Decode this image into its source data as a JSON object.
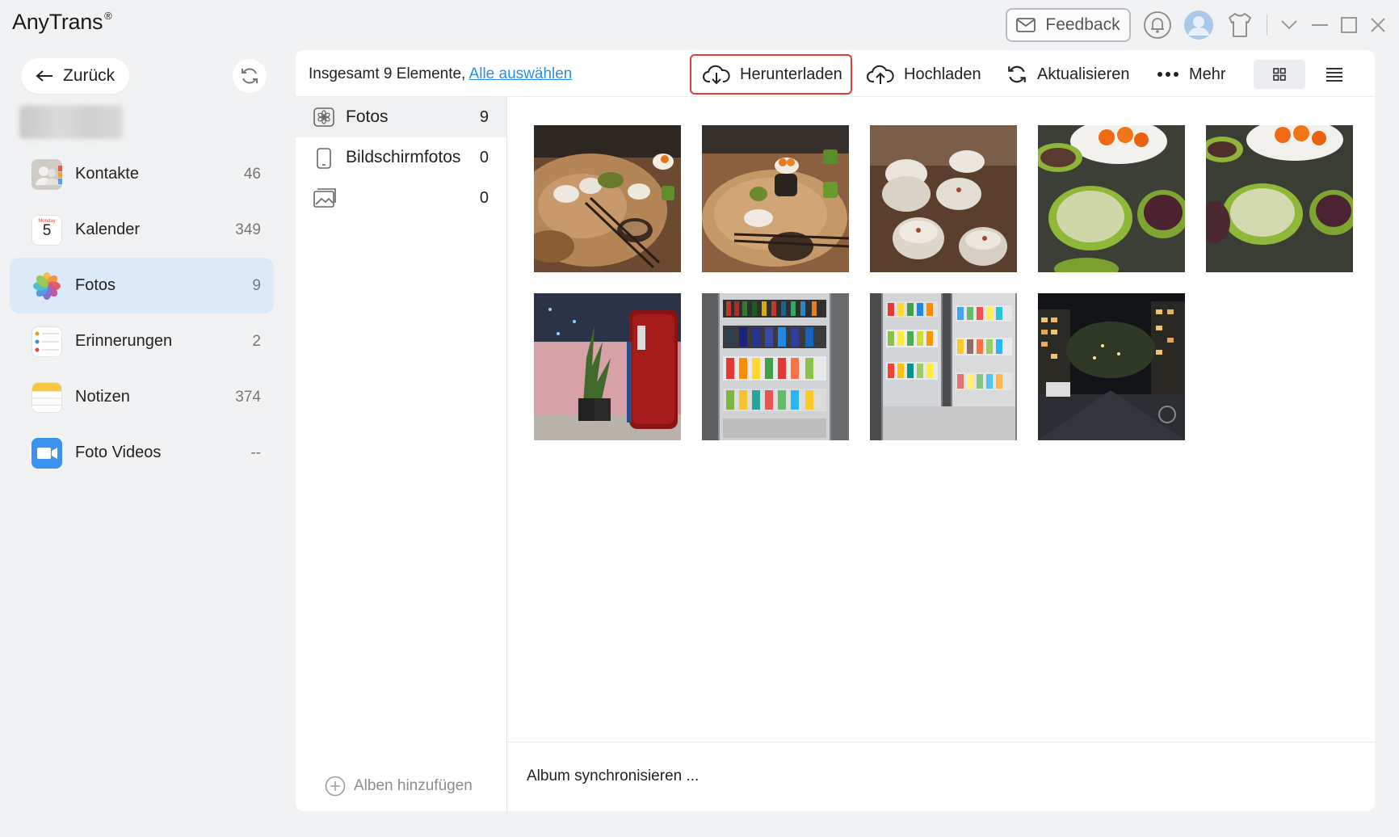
{
  "app": {
    "title": "AnyTrans",
    "registered": "®"
  },
  "titlebar": {
    "feedback_label": "Feedback"
  },
  "sidebar": {
    "back_label": "Zurück",
    "items": [
      {
        "label": "Kontakte",
        "count": "46",
        "icon": "contacts-icon"
      },
      {
        "label": "Kalender",
        "count": "349",
        "icon": "calendar-icon",
        "day": "5"
      },
      {
        "label": "Fotos",
        "count": "9",
        "icon": "photos-icon",
        "active": true
      },
      {
        "label": "Erinnerungen",
        "count": "2",
        "icon": "reminders-icon"
      },
      {
        "label": "Notizen",
        "count": "374",
        "icon": "notes-icon"
      },
      {
        "label": "Foto Videos",
        "count": "--",
        "icon": "video-icon"
      }
    ]
  },
  "toolbar": {
    "total_label": "Insgesamt 9 Elemente,",
    "select_all_label": "Alle auswählen",
    "download_label": "Herunterladen",
    "upload_label": "Hochladen",
    "refresh_label": "Aktualisieren",
    "more_label": "Mehr"
  },
  "albums": {
    "items": [
      {
        "label": "Fotos",
        "count": "9",
        "icon": "photos-album-icon"
      },
      {
        "label": "Bildschirmfotos",
        "count": "0",
        "icon": "screenshot-icon"
      },
      {
        "label": "",
        "count": "0",
        "icon": "image-icon"
      }
    ],
    "add_label": "Alben hinzufügen"
  },
  "photos": {
    "count": 9,
    "items": [
      {
        "scene": "food-table-1"
      },
      {
        "scene": "food-table-2"
      },
      {
        "scene": "food-bowls"
      },
      {
        "scene": "tea-cups-1"
      },
      {
        "scene": "tea-cups-2"
      },
      {
        "scene": "fridge-pink-wall"
      },
      {
        "scene": "store-shelf-1"
      },
      {
        "scene": "store-shelf-2"
      },
      {
        "scene": "night-street"
      }
    ]
  },
  "footer": {
    "sync_label": "Album synchronisieren ..."
  },
  "colors": {
    "accent_blue": "#2b8ee6",
    "highlight_red": "#e23b3b",
    "active_bg": "#dbe9f9"
  }
}
